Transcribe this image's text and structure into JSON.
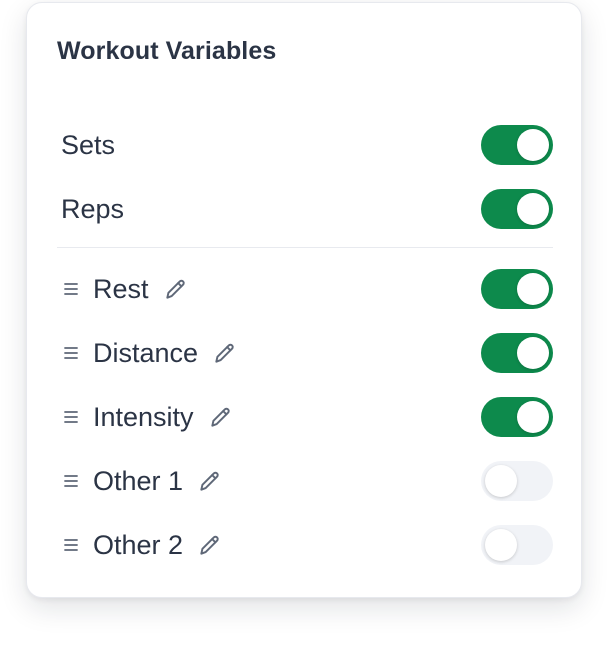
{
  "card": {
    "title": "Workout Variables"
  },
  "fixed_variables": [
    {
      "label": "Sets",
      "enabled": true
    },
    {
      "label": "Reps",
      "enabled": true
    }
  ],
  "custom_variables": [
    {
      "label": "Rest",
      "enabled": true
    },
    {
      "label": "Distance",
      "enabled": true
    },
    {
      "label": "Intensity",
      "enabled": true
    },
    {
      "label": "Other 1",
      "enabled": false
    },
    {
      "label": "Other 2",
      "enabled": false
    }
  ],
  "icons": {
    "drag": "drag-handle-icon",
    "edit": "pencil-icon"
  },
  "colors": {
    "toggle_on": "#0d8a4c",
    "toggle_off": "#f1f3f7",
    "text": "#2b3445",
    "icon": "#5f6878"
  }
}
